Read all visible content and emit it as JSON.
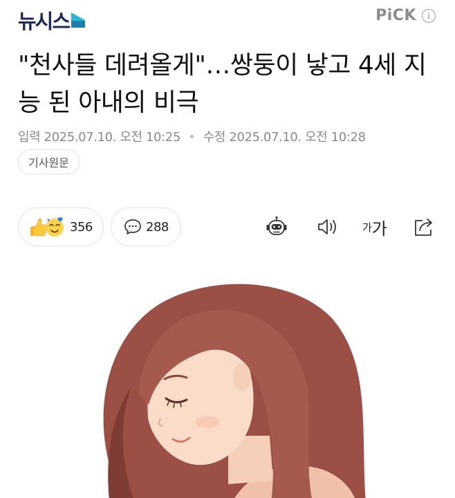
{
  "header": {
    "logo_text": "뉴시스",
    "pick_label": "PiCK",
    "info_label": "i"
  },
  "article": {
    "title": "\"천사들 데려올게\"…쌍둥이 낳고 4세 지능 된 아내의 비극",
    "published_label": "입력",
    "published_time": "2025.07.10. 오전 10:25",
    "updated_label": "수정",
    "updated_time": "2025.07.10. 오전 10:28",
    "source_button": "기사원문"
  },
  "actions": {
    "reaction_count": "356",
    "comment_count": "288",
    "font_small": "가",
    "font_big": "가"
  },
  "icons": {
    "logo_mark": "logo-mark-icon",
    "reaction": "reaction-emoji-icon",
    "comment": "speech-bubble-icon",
    "summary": "robot-summary-icon",
    "tts": "speaker-icon",
    "share": "share-icon"
  },
  "colors": {
    "logo_navy": "#1e2a56",
    "logo_accent": "#29b6d6",
    "meta_gray": "#8a8a8a",
    "hair": "#9b4f45",
    "skin": "#fbdcc8"
  }
}
